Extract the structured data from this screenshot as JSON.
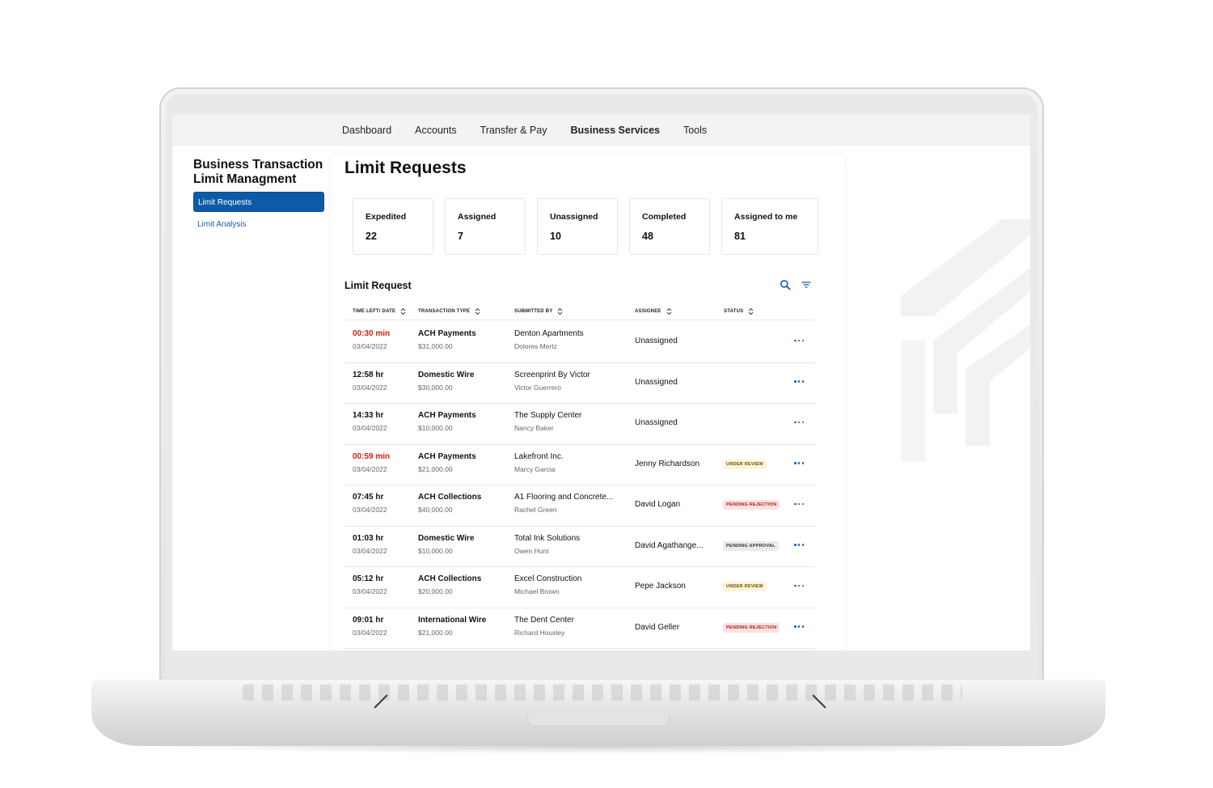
{
  "nav": {
    "items": [
      {
        "label": "Dashboard",
        "active": false
      },
      {
        "label": "Accounts",
        "active": false
      },
      {
        "label": "Transfer & Pay",
        "active": false
      },
      {
        "label": "Business Services",
        "active": true
      },
      {
        "label": "Tools",
        "active": false
      }
    ]
  },
  "sidebar": {
    "title": "Business Transaction Limit Managment",
    "items": [
      {
        "label": "Limit Requests",
        "active": true
      },
      {
        "label": "Limit Analysis",
        "active": false
      }
    ]
  },
  "main": {
    "title": "Limit Requests",
    "stats": [
      {
        "label": "Expedited",
        "value": "22"
      },
      {
        "label": "Assigned",
        "value": "7"
      },
      {
        "label": "Unassigned",
        "value": "10"
      },
      {
        "label": "Completed",
        "value": "48"
      },
      {
        "label": "Assigned to me",
        "value": "81"
      }
    ],
    "table": {
      "title": "Limit Request",
      "columns": [
        "TIME LEFT/ DATE",
        "TRANSACTION TYPE",
        "SUBMITTED BY",
        "ASSIGNEE",
        "STATUS"
      ],
      "rows": [
        {
          "time": "00:30 min",
          "urgent": true,
          "date": "03/04/2022",
          "type": "ACH Payments",
          "amount": "$31,000.00",
          "company": "Denton Apartments",
          "person": "Dolores  Mertz",
          "assignee": "Unassigned",
          "status": "",
          "status_kind": ""
        },
        {
          "time": "12:58 hr",
          "urgent": false,
          "date": "03/04/2022",
          "type": "Domestic Wire",
          "amount": "$30,000.00",
          "company": "Screenprint By Victor",
          "person": "Victor Guerrero",
          "assignee": "Unassigned",
          "status": "",
          "status_kind": ""
        },
        {
          "time": "14:33 hr",
          "urgent": false,
          "date": "03/04/2022",
          "type": "ACH Payments",
          "amount": "$10,000.00",
          "company": "The Supply Center",
          "person": "Nancy Baker",
          "assignee": "Unassigned",
          "status": "",
          "status_kind": ""
        },
        {
          "time": "00:59 min",
          "urgent": true,
          "date": "03/04/2022",
          "type": "ACH Payments",
          "amount": "$21,000.00",
          "company": "Lakefront Inc.",
          "person": "Marcy Garcia",
          "assignee": "Jenny Richardson",
          "status": "UNDER REVIEW",
          "status_kind": "review"
        },
        {
          "time": "07:45 hr",
          "urgent": false,
          "date": "03/04/2022",
          "type": "ACH Collections",
          "amount": "$40,000.00",
          "company": "A1 Flooring and Concrete...",
          "person": "Rachel Green",
          "assignee": "David Logan",
          "status": "PENDING REJECTION",
          "status_kind": "rejection"
        },
        {
          "time": "01:03 hr",
          "urgent": false,
          "date": "03/04/2022",
          "type": "Domestic Wire",
          "amount": "$10,000.00",
          "company": "Total Ink Solutions",
          "person": "Owen Hunt",
          "assignee": "David Agathange...",
          "status": "PENDING APPROVAL",
          "status_kind": "approval"
        },
        {
          "time": "05:12 hr",
          "urgent": false,
          "date": "03/04/2022",
          "type": "ACH Collections",
          "amount": "$20,000.00",
          "company": "Excel Construction",
          "person": "Michael Brown",
          "assignee": "Pepe Jackson",
          "status": "UNDER REVIEW",
          "status_kind": "review"
        },
        {
          "time": "09:01 hr",
          "urgent": false,
          "date": "03/04/2022",
          "type": "International Wire",
          "amount": "$21,000.00",
          "company": "The Dent Center",
          "person": "Richard Housley",
          "assignee": "David Geller",
          "status": "PENDING REJECTION",
          "status_kind": "rejection"
        }
      ]
    }
  },
  "icons": {
    "search": "search-icon",
    "filter": "filter-icon",
    "sort": "sort-icon",
    "more": "more-options-icon"
  },
  "colors": {
    "accent": "#0d5ba6",
    "urgent": "#c8201e",
    "review_bg": "#fdf3d8",
    "rejection_bg": "#fbe1e1",
    "approval_bg": "#ebebec"
  }
}
